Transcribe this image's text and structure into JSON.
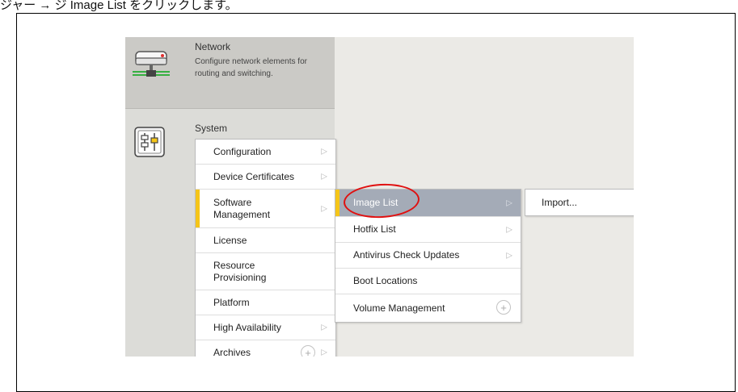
{
  "caption": "ジャー → ジ Image List をクリックします。",
  "network": {
    "title": "Network",
    "description": "Configure network elements for routing and switching."
  },
  "system": {
    "title": "System",
    "menu": [
      {
        "label": "Configuration",
        "has_submenu": true
      },
      {
        "label": "Device Certificates",
        "has_submenu": true
      },
      {
        "label": "Software Management",
        "has_submenu": true,
        "active": true
      },
      {
        "label": "License",
        "has_submenu": false
      },
      {
        "label": "Resource Provisioning",
        "has_submenu": false
      },
      {
        "label": "Platform",
        "has_submenu": false
      },
      {
        "label": "High Availability",
        "has_submenu": true
      },
      {
        "label": "Archives",
        "has_submenu": true,
        "has_add": true
      }
    ]
  },
  "software_management_menu": [
    {
      "label": "Image List",
      "has_submenu": true,
      "highlighted": true
    },
    {
      "label": "Hotfix List",
      "has_submenu": true
    },
    {
      "label": "Antivirus Check Updates",
      "has_submenu": true
    },
    {
      "label": "Boot Locations",
      "has_submenu": false
    },
    {
      "label": "Volume Management",
      "has_submenu": false,
      "has_add": true
    }
  ],
  "image_list_menu": [
    {
      "label": "Import..."
    }
  ],
  "icons": {
    "network": "network-device-icon",
    "system": "system-sliders-icon",
    "chevron": "chevron-right-icon",
    "add": "add-circle-icon"
  },
  "colors": {
    "highlight": "#a4abb7",
    "active_accent": "#f5c518",
    "annotation": "#e01010"
  }
}
